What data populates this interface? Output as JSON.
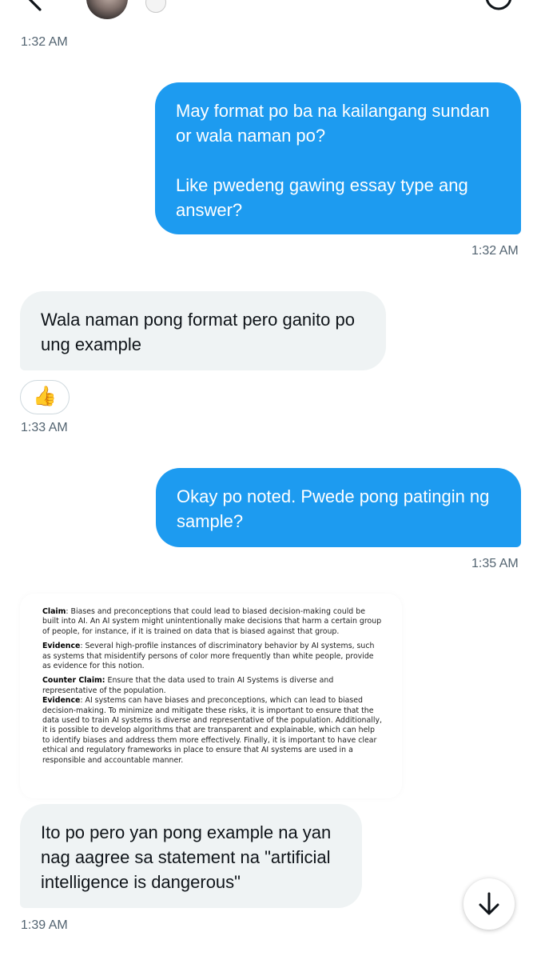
{
  "header": {
    "back_icon": "chevron-left-icon",
    "info_icon": "info-icon"
  },
  "messages": {
    "t1": "1:32 AM",
    "m1": "May format po ba na kailangang sundan\nor wala naman po?\n\nLike pwedeng gawing essay type ang\nanswer?",
    "t2": "1:32 AM",
    "m2": "Wala naman pong format pero ganito po\nung example",
    "reaction": "👍",
    "t3": "1:33 AM",
    "m3": "Okay po noted. Pwede pong patingin ng\nsample?",
    "t4": "1:35 AM",
    "m4": "Ito po pero yan pong example na yan\nnag aagree sa statement na \"artificial\nintelligence is dangerous\"",
    "t5": "1:39 AM"
  },
  "attachment": {
    "claim_label": "Claim",
    "claim_text": ": Biases and preconceptions that could lead to biased decision-making could be built into AI. An AI system might unintentionally make decisions that harm a certain group of people, for instance, if it is trained on data that is biased against that group.",
    "evidence1_label": "Evidence",
    "evidence1_text": ": Several high-profile instances of discriminatory behavior by AI systems, such as systems that misidentify persons of color more frequently than white people, provide as evidence for this notion.",
    "counter_label": "Counter Claim:",
    "counter_text": " Ensure that the data used to train AI Systems is diverse and representative of the population.",
    "evidence2_label": "Evidence",
    "evidence2_text": ": AI systems can have biases and preconceptions, which can lead to biased decision-making. To minimize and mitigate these risks, it is important to ensure that the data used to train AI systems is diverse and representative of the population. Additionally, it is possible to develop algorithms that are transparent and explainable, which can help to identify biases and address them more effectively. Finally, it is important to have clear ethical and regulatory frameworks in place to ensure that AI systems are used in a responsible and accountable manner."
  },
  "scroll_button": {
    "icon": "arrow-down-icon"
  }
}
